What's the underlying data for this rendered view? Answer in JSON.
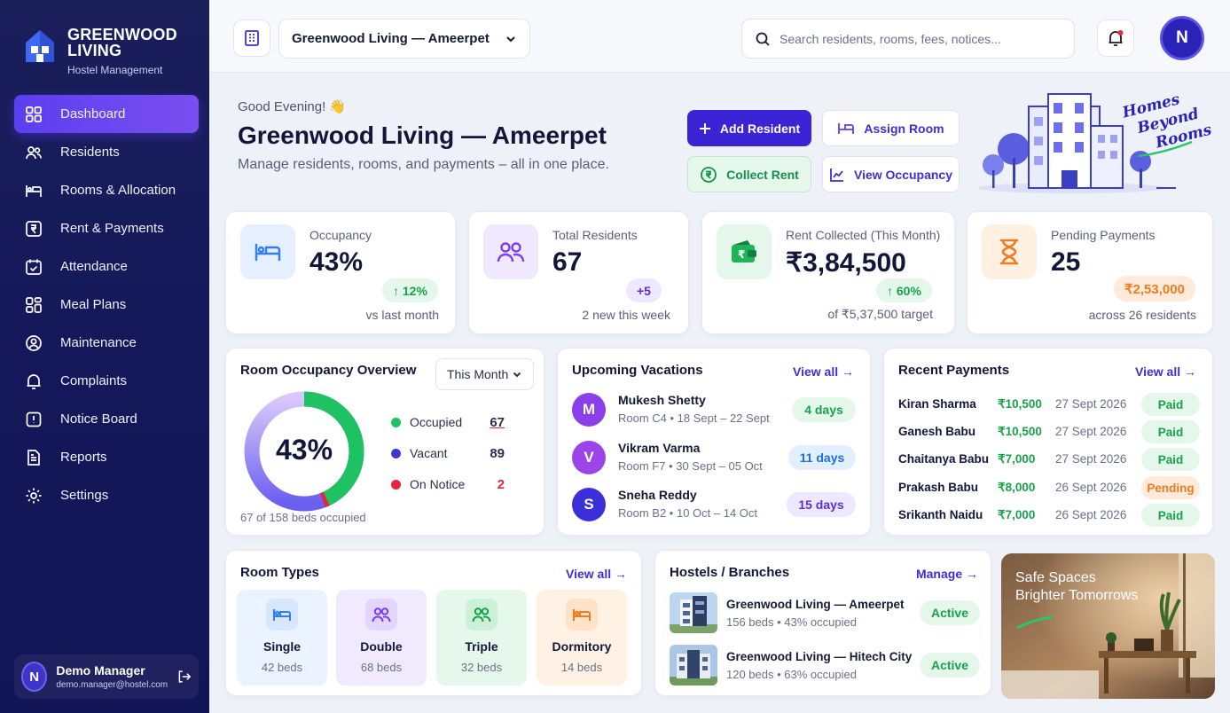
{
  "brand": {
    "title_line1": "GREENWOOD",
    "title_line2": "LIVING",
    "subtitle": "Hostel Management"
  },
  "nav": [
    {
      "label": "Dashboard",
      "icon": "grid-icon",
      "active": true
    },
    {
      "label": "Residents",
      "icon": "users-icon"
    },
    {
      "label": "Rooms & Allocation",
      "icon": "bed-icon"
    },
    {
      "label": "Rent & Payments",
      "icon": "rupee-icon"
    },
    {
      "label": "Attendance",
      "icon": "calendar-check-icon"
    },
    {
      "label": "Meal Plans",
      "icon": "meal-icon"
    },
    {
      "label": "Maintenance",
      "icon": "wrench-icon"
    },
    {
      "label": "Complaints",
      "icon": "bell-alert-icon"
    },
    {
      "label": "Notice Board",
      "icon": "notice-icon"
    },
    {
      "label": "Reports",
      "icon": "report-icon"
    },
    {
      "label": "Settings",
      "icon": "gear-icon"
    }
  ],
  "user": {
    "initial": "N",
    "name": "Demo Manager",
    "email": "demo.manager@hostel.com"
  },
  "topbar": {
    "branch": "Greenwood Living — Ameerpet",
    "search_placeholder": "Search residents, rooms, fees, notices...",
    "avatar_initial": "N"
  },
  "greeting": {
    "hello": "Good Evening! 👋",
    "title": "Greenwood Living — Ameerpet",
    "subtitle": "Manage residents, rooms, and payments – all in one place."
  },
  "actions": {
    "add_resident": "Add Resident",
    "assign_room": "Assign Room",
    "collect_rent": "Collect Rent",
    "view_occupancy": "View Occupancy"
  },
  "hero": {
    "tagline_1": "Homes",
    "tagline_2": "Beyond",
    "tagline_3": "Rooms"
  },
  "stats": {
    "occupancy": {
      "label": "Occupancy",
      "value": "43%",
      "change": "↑ 12%",
      "note": "vs last month"
    },
    "residents": {
      "label": "Total Residents",
      "value": "67",
      "change": "+5",
      "note": "2 new this week"
    },
    "rent": {
      "label": "Rent Collected (This Month)",
      "value": "₹3,84,500",
      "change": "↑ 60%",
      "note": "of ₹5,37,500 target"
    },
    "pending": {
      "label": "Pending Payments",
      "value": "25",
      "change": "₹2,53,000",
      "note": "across 26 residents"
    }
  },
  "occupancy_overview": {
    "title": "Room Occupancy Overview",
    "period": "This Month",
    "center": "43%",
    "footer": "67 of 158 beds occupied",
    "legend": [
      {
        "label": "Occupied",
        "value": "67",
        "color": "#1ec262"
      },
      {
        "label": "Vacant",
        "value": "89",
        "color": "#3b3ad8"
      },
      {
        "label": "On Notice",
        "value": "2",
        "color": "#e5263c"
      }
    ]
  },
  "vacations": {
    "title": "Upcoming Vacations",
    "view_all": "View all →",
    "items": [
      {
        "initial": "M",
        "name": "Mukesh Shetty",
        "detail": "Room C4 • 18 Sept – 22 Sept",
        "days": "4 days"
      },
      {
        "initial": "V",
        "name": "Vikram Varma",
        "detail": "Room F7 • 30 Sept – 05 Oct",
        "days": "11 days"
      },
      {
        "initial": "S",
        "name": "Sneha Reddy",
        "detail": "Room B2 • 10 Oct – 14 Oct",
        "days": "15 days"
      }
    ]
  },
  "payments": {
    "title": "Recent Payments",
    "view_all": "View all →",
    "rows": [
      {
        "name": "Kiran Sharma",
        "amount": "₹10,500",
        "date": "27 Sept 2026",
        "status": "Paid"
      },
      {
        "name": "Ganesh Babu",
        "amount": "₹10,500",
        "date": "27 Sept 2026",
        "status": "Paid"
      },
      {
        "name": "Chaitanya Babu",
        "amount": "₹7,000",
        "date": "27 Sept 2026",
        "status": "Paid"
      },
      {
        "name": "Prakash Babu",
        "amount": "₹8,000",
        "date": "26 Sept 2026",
        "status": "Pending"
      },
      {
        "name": "Srikanth Naidu",
        "amount": "₹7,000",
        "date": "26 Sept 2026",
        "status": "Paid"
      }
    ]
  },
  "room_types": {
    "title": "Room Types",
    "view_all": "View all →",
    "items": [
      {
        "name": "Single",
        "beds": "42 beds"
      },
      {
        "name": "Double",
        "beds": "68 beds"
      },
      {
        "name": "Triple",
        "beds": "32 beds"
      },
      {
        "name": "Dormitory",
        "beds": "14 beds"
      }
    ]
  },
  "hostels": {
    "title": "Hostels / Branches",
    "manage": "Manage →",
    "items": [
      {
        "name": "Greenwood Living — Ameerpet",
        "detail": "156 beds • 43% occupied",
        "status": "Active"
      },
      {
        "name": "Greenwood Living — Hitech City",
        "detail": "120 beds • 63% occupied",
        "status": "Active"
      }
    ]
  },
  "promo": {
    "line1": "Safe Spaces",
    "line2": "Brighter Tomorrows"
  }
}
